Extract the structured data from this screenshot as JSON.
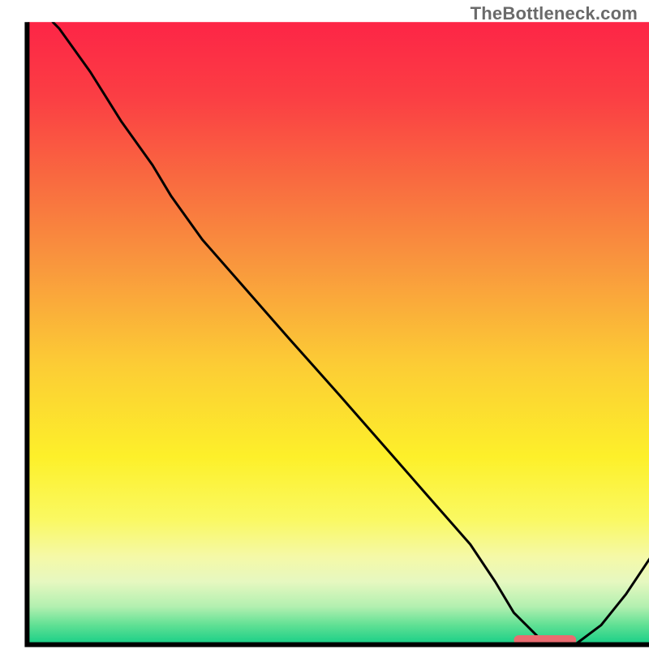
{
  "watermark": "TheBottleneck.com",
  "chart_data": {
    "type": "line",
    "title": "",
    "xlabel": "",
    "ylabel": "",
    "xlim": [
      0,
      100
    ],
    "ylim": [
      0,
      100
    ],
    "x": [
      4,
      5,
      10,
      15,
      20,
      23,
      28,
      35,
      42,
      50,
      57,
      64,
      71,
      75,
      78,
      82,
      85,
      88,
      92,
      96,
      100
    ],
    "values": [
      100,
      99,
      92,
      84,
      77,
      72,
      65,
      57,
      49,
      40,
      32,
      24,
      16,
      10,
      5,
      1,
      0,
      0,
      3,
      8,
      14
    ],
    "marker_segment": {
      "x_start": 78,
      "x_end": 88,
      "y": 0.6,
      "color": "#ea6b70"
    },
    "background_gradient_stops": [
      {
        "offset": 0.0,
        "color": "#fd2546"
      },
      {
        "offset": 0.12,
        "color": "#fb3e44"
      },
      {
        "offset": 0.25,
        "color": "#f96940"
      },
      {
        "offset": 0.4,
        "color": "#f99a3d"
      },
      {
        "offset": 0.55,
        "color": "#fccc35"
      },
      {
        "offset": 0.7,
        "color": "#fdf02a"
      },
      {
        "offset": 0.8,
        "color": "#faf962"
      },
      {
        "offset": 0.86,
        "color": "#f5f9a7"
      },
      {
        "offset": 0.9,
        "color": "#e6f8c0"
      },
      {
        "offset": 0.94,
        "color": "#b3f0b0"
      },
      {
        "offset": 0.97,
        "color": "#60e094"
      },
      {
        "offset": 1.0,
        "color": "#18cf87"
      }
    ],
    "axis": {
      "border_color": "#000000",
      "border_width": 6,
      "inner_bg_rect": {
        "x": 4.3,
        "y": 3.4,
        "w": 96.0,
        "h": 95.8
      }
    }
  }
}
